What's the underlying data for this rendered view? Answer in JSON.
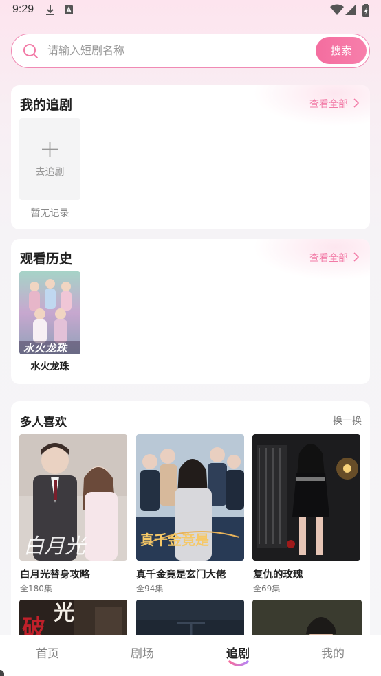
{
  "status_bar": {
    "time": "9:29"
  },
  "search": {
    "placeholder": "请输入短剧名称",
    "button_label": "搜索"
  },
  "my_follows": {
    "title": "我的追剧",
    "view_all": "查看全部",
    "add_label": "去追剧",
    "empty_text": "暂无记录"
  },
  "history": {
    "title": "观看历史",
    "view_all": "查看全部",
    "items": [
      {
        "title": "水火龙珠",
        "poster_text": "水火龙珠"
      }
    ]
  },
  "popular": {
    "title": "多人喜欢",
    "refresh": "换一换",
    "items": [
      {
        "title": "白月光替身攻略",
        "episodes": "全180集",
        "poster_text": "白月光"
      },
      {
        "title": "真千金竟是玄门大佬",
        "episodes": "全94集",
        "poster_text": "真千金竟是"
      },
      {
        "title": "复仇的玫瑰",
        "episodes": "全69集"
      }
    ],
    "next_row_poster_texts": [
      "破",
      "光"
    ]
  },
  "tabs": [
    {
      "label": "首页",
      "active": false
    },
    {
      "label": "剧场",
      "active": false
    },
    {
      "label": "追剧",
      "active": true
    },
    {
      "label": "我的",
      "active": false
    }
  ],
  "colors": {
    "accent": "#f46d9f",
    "accent_text": "#f27aa6"
  }
}
